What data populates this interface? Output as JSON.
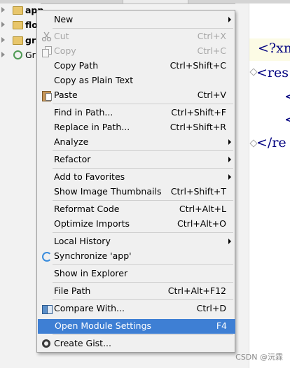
{
  "tree": {
    "items": [
      {
        "label": "app",
        "icon": "folder-icon",
        "expanded": false
      },
      {
        "label": "flo",
        "icon": "folder-icon",
        "expanded": false
      },
      {
        "label": "gr",
        "icon": "folder-icon",
        "expanded": false
      },
      {
        "label": "Gr",
        "icon": "gradle-icon",
        "expanded": false
      }
    ]
  },
  "editor": {
    "lines": [
      "<?xm",
      "<res",
      "<",
      "<",
      "</re"
    ],
    "colors": {
      "tag": "#000080"
    }
  },
  "context_menu": {
    "items": [
      {
        "label": "New",
        "shortcut": "",
        "submenu": true
      },
      {
        "label": "Cut",
        "shortcut": "Ctrl+X",
        "disabled": true,
        "icon": "scissors-icon"
      },
      {
        "label": "Copy",
        "shortcut": "Ctrl+C",
        "disabled": true,
        "icon": "copy-icon"
      },
      {
        "label": "Copy Path",
        "shortcut": "Ctrl+Shift+C"
      },
      {
        "label": "Copy as Plain Text",
        "shortcut": ""
      },
      {
        "label": "Paste",
        "shortcut": "Ctrl+V",
        "icon": "paste-icon"
      },
      {
        "label": "Find in Path...",
        "shortcut": "Ctrl+Shift+F"
      },
      {
        "label": "Replace in Path...",
        "shortcut": "Ctrl+Shift+R"
      },
      {
        "label": "Analyze",
        "shortcut": "",
        "submenu": true
      },
      {
        "label": "Refactor",
        "shortcut": "",
        "submenu": true
      },
      {
        "label": "Add to Favorites",
        "shortcut": "",
        "submenu": true
      },
      {
        "label": "Show Image Thumbnails",
        "shortcut": "Ctrl+Shift+T"
      },
      {
        "label": "Reformat Code",
        "shortcut": "Ctrl+Alt+L"
      },
      {
        "label": "Optimize Imports",
        "shortcut": "Ctrl+Alt+O"
      },
      {
        "label": "Local History",
        "shortcut": "",
        "submenu": true
      },
      {
        "label": "Synchronize 'app'",
        "shortcut": "",
        "icon": "sync-icon"
      },
      {
        "label": "Show in Explorer",
        "shortcut": ""
      },
      {
        "label": "File Path",
        "shortcut": "Ctrl+Alt+F12"
      },
      {
        "label": "Compare With...",
        "shortcut": "Ctrl+D",
        "icon": "compare-icon"
      },
      {
        "label": "Open Module Settings",
        "shortcut": "F4",
        "selected": true
      },
      {
        "label": "Create Gist...",
        "shortcut": "",
        "icon": "gist-icon"
      }
    ],
    "colors": {
      "selected_bg": "#3e7fd4",
      "disabled_text": "#a6a6a6"
    }
  },
  "watermark": "CSDN @沅霖"
}
